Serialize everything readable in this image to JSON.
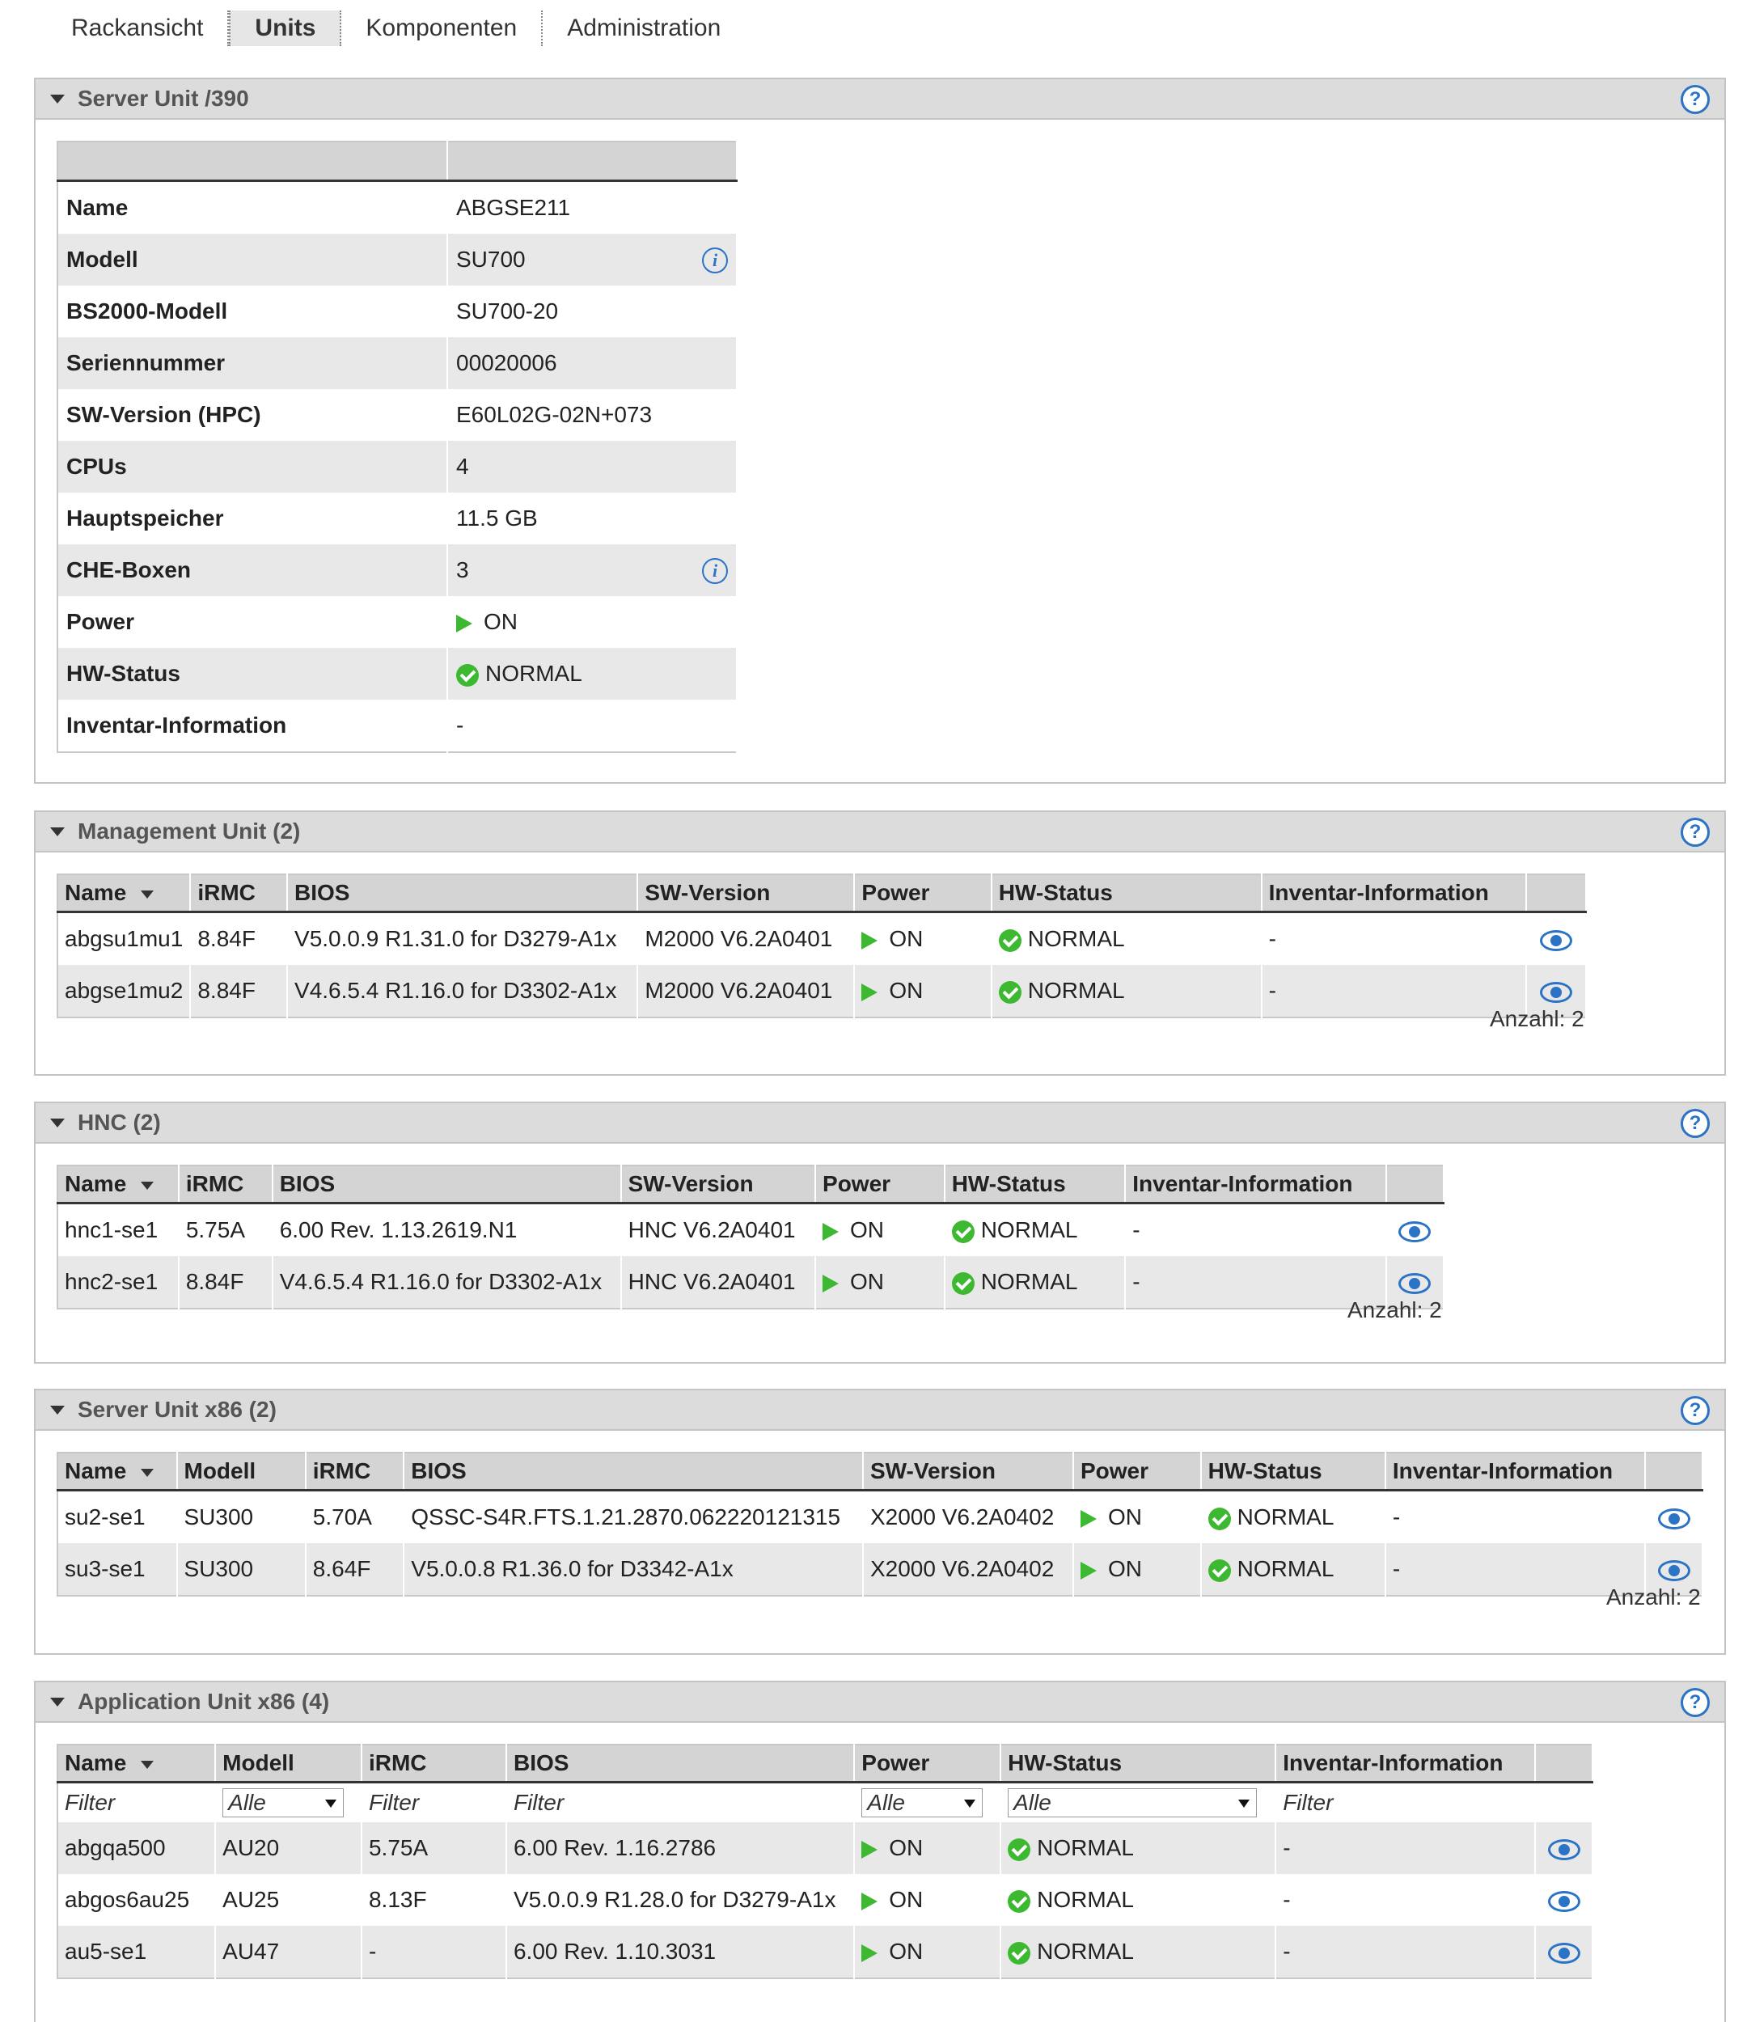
{
  "nav": {
    "tabs": [
      {
        "label": "Rackansicht"
      },
      {
        "label": "Units"
      },
      {
        "label": "Komponenten"
      },
      {
        "label": "Administration"
      }
    ]
  },
  "server_unit_390": {
    "title": "Server Unit /390",
    "rows": [
      {
        "key": "Name",
        "value": "ABGSE211"
      },
      {
        "key": "Modell",
        "value": "SU700",
        "info": true
      },
      {
        "key": "BS2000-Modell",
        "value": "SU700-20"
      },
      {
        "key": "Seriennummer",
        "value": "00020006"
      },
      {
        "key": "SW-Version (HPC)",
        "value": "E60L02G-02N+073"
      },
      {
        "key": "CPUs",
        "value": "4"
      },
      {
        "key": "Hauptspeicher",
        "value": "11.5 GB"
      },
      {
        "key": "CHE-Boxen",
        "value": "3",
        "info": true
      },
      {
        "key": "Power",
        "value": "ON",
        "status": "power"
      },
      {
        "key": "HW-Status",
        "value": "NORMAL",
        "status": "ok"
      },
      {
        "key": "Inventar-Information",
        "value": "-"
      }
    ]
  },
  "management_unit": {
    "title": "Management Unit (2)",
    "columns": [
      "Name",
      "iRMC",
      "BIOS",
      "SW-Version",
      "Power",
      "HW-Status",
      "Inventar-Information",
      ""
    ],
    "rows": [
      {
        "name": "abgsu1mu1",
        "irmc": "8.84F",
        "bios": "V5.0.0.9 R1.31.0 for D3279-A1x",
        "sw": "M2000 V6.2A0401",
        "power": "ON",
        "hw": "NORMAL",
        "inv": "-"
      },
      {
        "name": "abgse1mu2",
        "irmc": "8.84F",
        "bios": "V4.6.5.4 R1.16.0 for D3302-A1x",
        "sw": "M2000 V6.2A0401",
        "power": "ON",
        "hw": "NORMAL",
        "inv": "-"
      }
    ],
    "count": "Anzahl: 2"
  },
  "hnc": {
    "title": "HNC (2)",
    "columns": [
      "Name",
      "iRMC",
      "BIOS",
      "SW-Version",
      "Power",
      "HW-Status",
      "Inventar-Information",
      ""
    ],
    "rows": [
      {
        "name": "hnc1-se1",
        "irmc": "5.75A",
        "bios": "6.00 Rev. 1.13.2619.N1",
        "sw": "HNC V6.2A0401",
        "power": "ON",
        "hw": "NORMAL",
        "inv": "-"
      },
      {
        "name": "hnc2-se1",
        "irmc": "8.84F",
        "bios": "V4.6.5.4 R1.16.0 for D3302-A1x",
        "sw": "HNC V6.2A0401",
        "power": "ON",
        "hw": "NORMAL",
        "inv": "-"
      }
    ],
    "count": "Anzahl: 2"
  },
  "server_unit_x86": {
    "title": "Server Unit x86 (2)",
    "columns": [
      "Name",
      "Modell",
      "iRMC",
      "BIOS",
      "SW-Version",
      "Power",
      "HW-Status",
      "Inventar-Information",
      ""
    ],
    "rows": [
      {
        "name": "su2-se1",
        "model": "SU300",
        "irmc": "5.70A",
        "bios": "QSSC-S4R.FTS.1.21.2870.062220121315",
        "sw": "X2000 V6.2A0402",
        "power": "ON",
        "hw": "NORMAL",
        "inv": "-"
      },
      {
        "name": "su3-se1",
        "model": "SU300",
        "irmc": "8.64F",
        "bios": "V5.0.0.8 R1.36.0 for D3342-A1x",
        "sw": "X2000 V6.2A0402",
        "power": "ON",
        "hw": "NORMAL",
        "inv": "-"
      }
    ],
    "count": "Anzahl: 2"
  },
  "application_unit_x86": {
    "title": "Application Unit x86 (4)",
    "columns": [
      "Name",
      "Modell",
      "iRMC",
      "BIOS",
      "Power",
      "HW-Status",
      "Inventar-Information",
      ""
    ],
    "filters": {
      "name": "Filter",
      "model": "Alle",
      "irmc": "Filter",
      "bios": "Filter",
      "power": "Alle",
      "hw": "Alle",
      "inv": "Filter"
    },
    "rows": [
      {
        "name": "abgqa500",
        "model": "AU20",
        "irmc": "5.75A",
        "bios": "6.00 Rev. 1.16.2786",
        "power": "ON",
        "hw": "NORMAL",
        "inv": "-"
      },
      {
        "name": "abgos6au25",
        "model": "AU25",
        "irmc": "8.13F",
        "bios": "V5.0.0.9 R1.28.0 for D3279-A1x",
        "power": "ON",
        "hw": "NORMAL",
        "inv": "-"
      },
      {
        "name": "au5-se1",
        "model": "AU47",
        "irmc": "-",
        "bios": "6.00 Rev. 1.10.3031",
        "power": "ON",
        "hw": "NORMAL",
        "inv": "-"
      }
    ]
  },
  "icons": {
    "help": "?",
    "info": "i",
    "power_color": "#3cb930",
    "ok_color": "#3cb930",
    "link_color": "#2a73c5"
  }
}
